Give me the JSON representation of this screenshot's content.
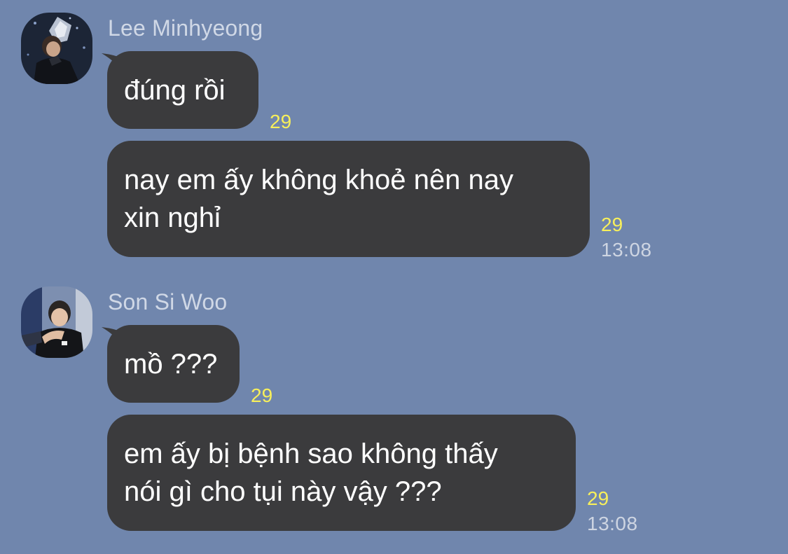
{
  "colors": {
    "background": "#7086ad",
    "bubble": "#3b3b3d",
    "bubble_text": "#ffffff",
    "read_count": "#f7ef5b",
    "sender_name": "#d0d8e6",
    "timestamp": "#ced5e2"
  },
  "groups": [
    {
      "sender": "Lee Minhyeong",
      "avatar_icon": "profile-photo",
      "messages": [
        {
          "text": "đúng rồi",
          "read_count": "29"
        },
        {
          "text_lines": [
            "nay em ấy không khoẻ nên nay",
            "xin nghỉ"
          ],
          "read_count": "29",
          "time": "13:08"
        }
      ]
    },
    {
      "sender": "Son Si Woo",
      "avatar_icon": "profile-photo",
      "messages": [
        {
          "text": "mồ ???",
          "read_count": "29"
        },
        {
          "text_lines": [
            "em ấy bị bệnh sao không thấy",
            "nói gì cho tụi này vậy ???"
          ],
          "read_count": "29",
          "time": "13:08"
        }
      ]
    }
  ]
}
